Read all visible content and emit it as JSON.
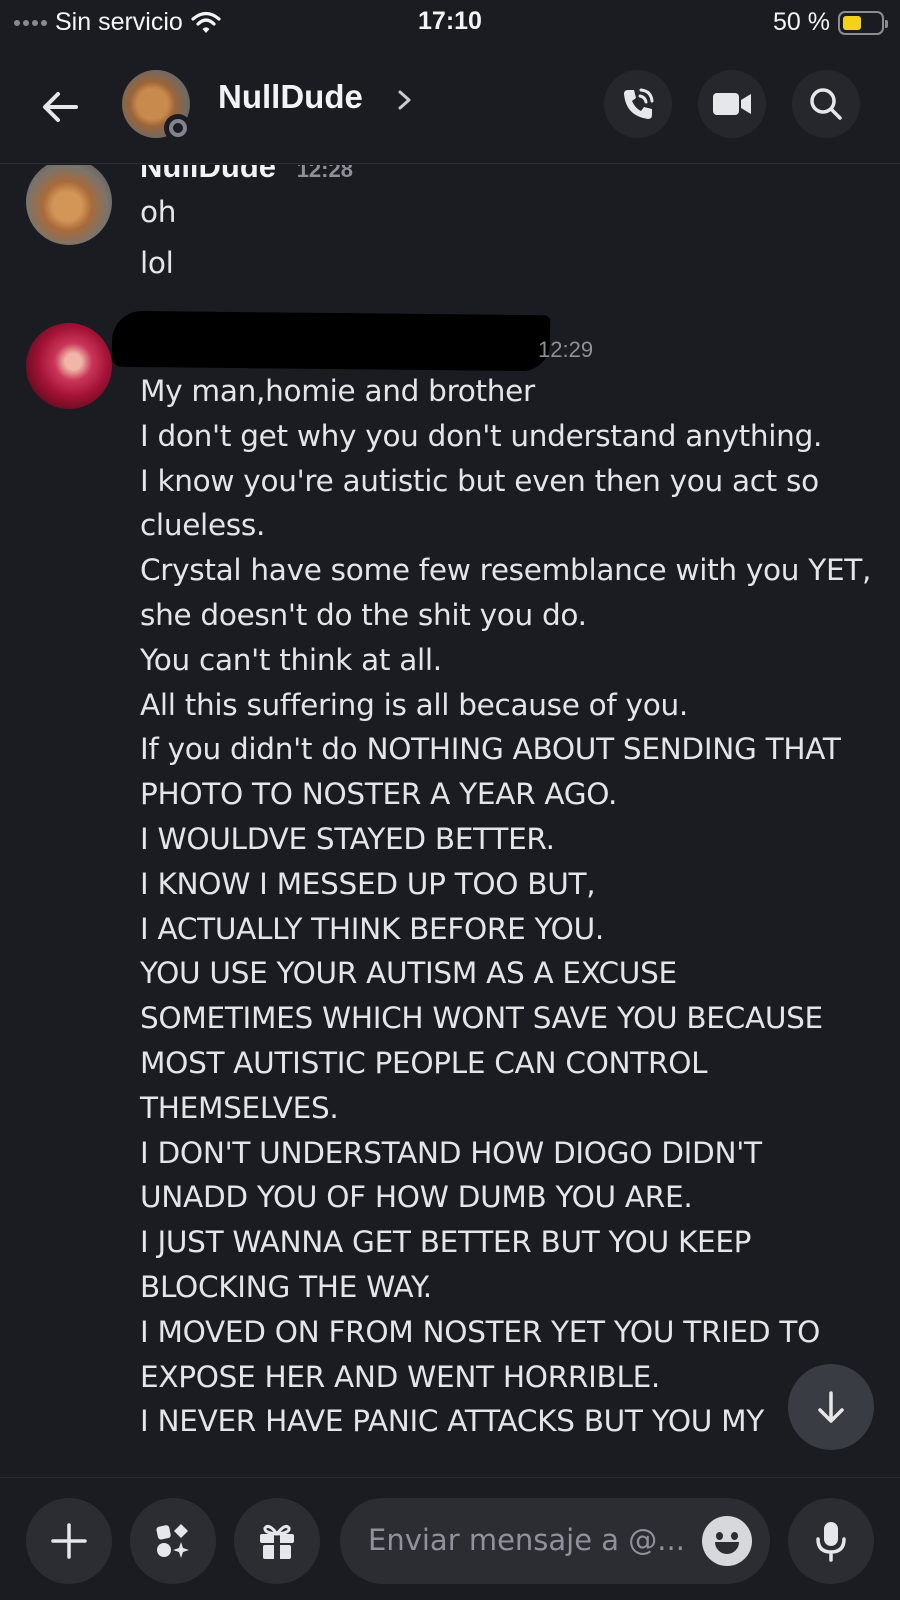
{
  "status_bar": {
    "carrier": "Sin servicio",
    "time": "17:10",
    "battery": "50 %",
    "battery_level": 0.5
  },
  "header": {
    "title": "NullDude",
    "icons": [
      "back-arrow-icon",
      "voice-call-icon",
      "video-call-icon",
      "search-icon"
    ]
  },
  "messages": [
    {
      "author": "NullDude",
      "time": "12:28",
      "lines": [
        "oh",
        "lol"
      ]
    },
    {
      "author": "",
      "time": "12:29",
      "lines": [
        "My man,homie and brother",
        "I don't get why you don't understand anything.",
        "I know you're autistic but even then you act so",
        "clueless.",
        "Crystal have some few resemblance with you YET,",
        "she doesn't do the shit you do.",
        "You can't think at all.",
        "All this suffering is all because of you.",
        "If you didn't do NOTHING ABOUT SENDING THAT",
        "PHOTO TO NOSTER A YEAR AGO.",
        "I WOULDVE STAYED BETTER.",
        "I KNOW I MESSED UP TOO BUT,",
        "I ACTUALLY THINK BEFORE YOU.",
        "YOU USE YOUR AUTISM AS A EXCUSE",
        "SOMETIMES WHICH WONT SAVE YOU BECAUSE",
        "MOST AUTISTIC PEOPLE CAN CONTROL",
        "THEMSELVES.",
        "I DON'T UNDERSTAND HOW DIOGO DIDN'T",
        "UNADD YOU OF HOW DUMB YOU ARE.",
        "I JUST WANNA GET BETTER BUT YOU KEEP",
        "BLOCKING THE WAY.",
        "I MOVED ON FROM NOSTER YET YOU TRIED TO",
        "EXPOSE HER AND WENT HORRIBLE.",
        "I NEVER HAVE PANIC ATTACKS BUT YOU MY"
      ]
    }
  ],
  "composer": {
    "placeholder": "Enviar mensaje a @..."
  },
  "colors": {
    "background": "#1b1c21",
    "surface": "#2b2d33",
    "text": "#e4e5e8",
    "muted": "#8d9097",
    "battery": "#f3d21a"
  }
}
